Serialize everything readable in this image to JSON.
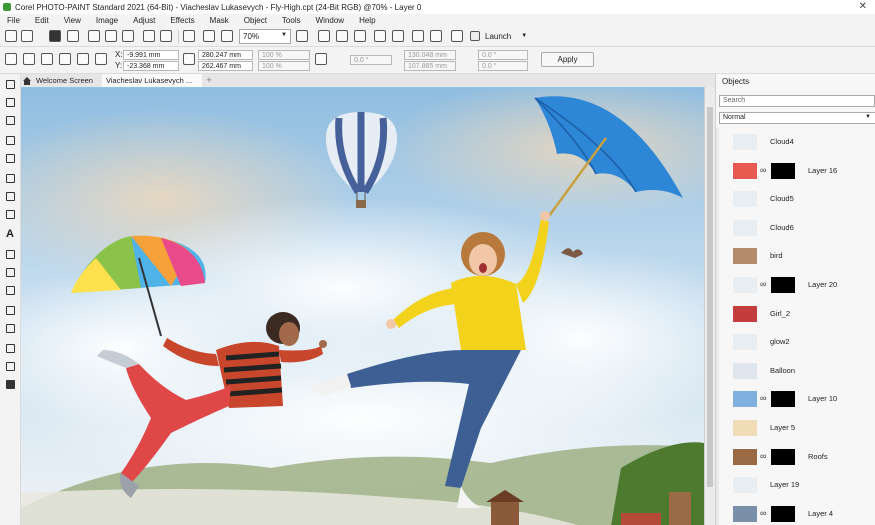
{
  "window": {
    "title": "Corel PHOTO-PAINT Standard 2021 (64-Bit) - Viacheslav Lukasevych - Fly-High.cpt (24-Bit RGB) @70% - Layer 0",
    "close": "✕"
  },
  "menu": [
    "File",
    "Edit",
    "View",
    "Image",
    "Adjust",
    "Effects",
    "Mask",
    "Object",
    "Tools",
    "Window",
    "Help"
  ],
  "toolbar": {
    "zoom": "70%",
    "launch_label": "Launch"
  },
  "property_bar": {
    "x_label": "X:",
    "y_label": "Y:",
    "x_value": "-9.991 mm",
    "y_value": "-23.368 mm",
    "width": "280.247 mm",
    "height": "262.467 mm",
    "scale_w": "100 %",
    "scale_h": "100 %",
    "rotation": "0.0 °",
    "center_x": "130.048 mm",
    "center_y": "107.865 mm",
    "skew_h": "0.0 °",
    "skew_v": "0.0 °",
    "apply_label": "Apply"
  },
  "doc_tabs": {
    "tabs": [
      "Welcome Screen",
      "Viacheslav Lukasevych ..."
    ],
    "add": "+"
  },
  "objects_panel": {
    "title": "Objects",
    "search_placeholder": "Search",
    "blend_mode": "Normal",
    "layers": [
      {
        "name": "Cloud4",
        "mask": false
      },
      {
        "name": "Layer 16",
        "mask": true
      },
      {
        "name": "Cloud5",
        "mask": false
      },
      {
        "name": "Cloud6",
        "mask": false
      },
      {
        "name": "bird",
        "mask": false
      },
      {
        "name": "Layer 20",
        "mask": true
      },
      {
        "name": "Girl_2",
        "mask": false
      },
      {
        "name": "glow2",
        "mask": false
      },
      {
        "name": "Balloon",
        "mask": false
      },
      {
        "name": "Layer 10",
        "mask": true
      },
      {
        "name": "Layer 5",
        "mask": false
      },
      {
        "name": "Roofs",
        "mask": true
      },
      {
        "name": "Layer 19",
        "mask": false
      },
      {
        "name": "Layer 4",
        "mask": true
      }
    ]
  },
  "colors": {
    "sky_top": "#8fbde0",
    "sky_bottom": "#dce9f3",
    "umbrella_blue": "#2d86d6",
    "sweater_yellow": "#f2d21a",
    "jeans": "#3d5f94",
    "pants_red": "#e04848"
  }
}
